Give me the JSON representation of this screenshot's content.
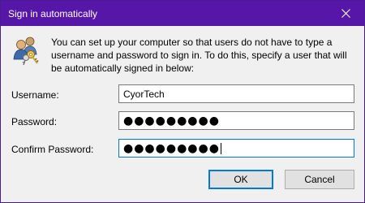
{
  "window": {
    "title": "Sign in automatically",
    "close_glyph": "close-icon"
  },
  "description": "You can set up your computer so that users do not have to type a username and password to sign in. To do this, specify a user that will be automatically signed in below:",
  "form": {
    "username": {
      "label": "Username:",
      "value": "CyorTech"
    },
    "password": {
      "label": "Password:",
      "value": "●●●●●●●●●"
    },
    "confirm_password": {
      "label": "Confirm Password:",
      "value": "●●●●●●●●●"
    }
  },
  "buttons": {
    "ok": "OK",
    "cancel": "Cancel"
  },
  "colors": {
    "titlebar": "#5616a7",
    "accent": "#0078d7",
    "window_bg": "#f0f0f0"
  },
  "icons": {
    "header_icon": "users-keys-icon"
  }
}
